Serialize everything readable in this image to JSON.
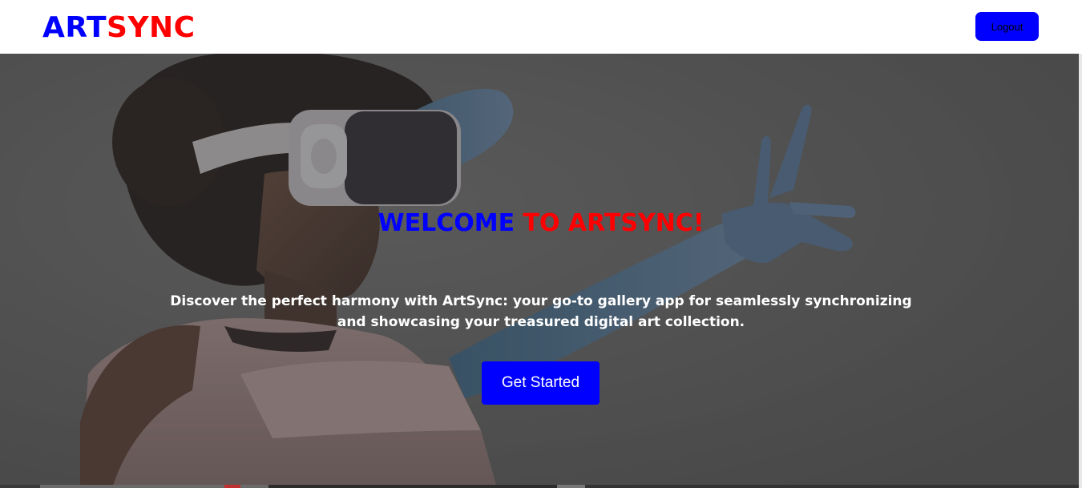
{
  "header": {
    "logo_part1": "ART",
    "logo_part2": "SYNC",
    "logout_label": "Logout"
  },
  "hero": {
    "welcome_part1": "WELCOME ",
    "welcome_part2": "TO ARTSYNC!",
    "tagline": "Discover the perfect harmony with ArtSync: your go-to gallery app for seamlessly synchronizing and showcasing your treasured digital art collection.",
    "cta_label": "Get Started",
    "image_subject": "woman-wearing-vr-headset"
  },
  "colors": {
    "brand_blue": "#0000ff",
    "brand_red": "#ff0000",
    "tagline_text": "#ffffff"
  }
}
